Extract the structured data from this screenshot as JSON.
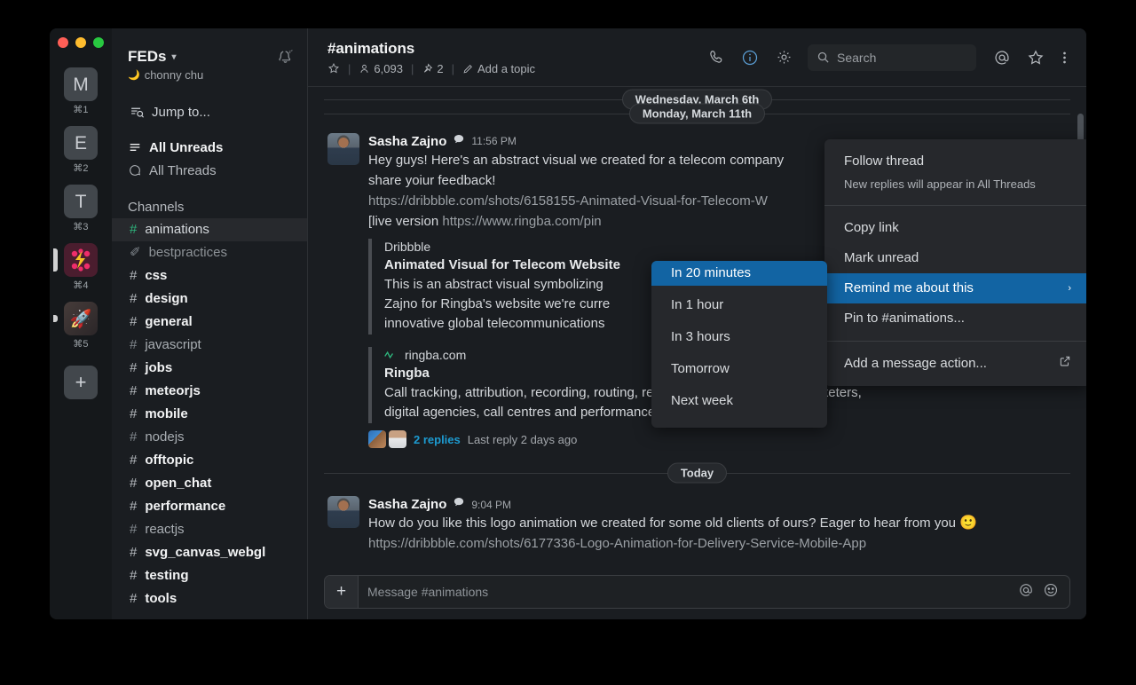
{
  "window": {
    "traffic_lights": [
      "close",
      "minimize",
      "maximize"
    ]
  },
  "rail": {
    "workspaces": [
      {
        "label": "M",
        "shortcut": "⌘1",
        "type": "letter"
      },
      {
        "label": "E",
        "shortcut": "⌘2",
        "type": "letter"
      },
      {
        "label": "T",
        "shortcut": "⌘3",
        "type": "letter"
      },
      {
        "label": "F",
        "shortcut": "⌘4",
        "type": "logo-f"
      },
      {
        "label": "🚀",
        "shortcut": "⌘5",
        "type": "logo-rocket"
      }
    ],
    "add_label": "+"
  },
  "sidebar": {
    "workspace_name": "FEDs",
    "caret": "⌄",
    "user_name": "chonny chu",
    "bell_icon": "notifications-snoozed-icon",
    "jump_to": "Jump to...",
    "quick_links": [
      {
        "label": "All Unreads",
        "strong": true
      },
      {
        "label": "All Threads",
        "strong": false
      }
    ],
    "section_title": "Channels",
    "channels": [
      {
        "name": "animations",
        "prefix": "#",
        "state": "active"
      },
      {
        "name": "bestpractices",
        "prefix": "✐",
        "state": "muted"
      },
      {
        "name": "css",
        "prefix": "#",
        "state": "unread"
      },
      {
        "name": "design",
        "prefix": "#",
        "state": "unread"
      },
      {
        "name": "general",
        "prefix": "#",
        "state": "unread"
      },
      {
        "name": "javascript",
        "prefix": "#",
        "state": "read"
      },
      {
        "name": "jobs",
        "prefix": "#",
        "state": "unread"
      },
      {
        "name": "meteorjs",
        "prefix": "#",
        "state": "unread"
      },
      {
        "name": "mobile",
        "prefix": "#",
        "state": "unread"
      },
      {
        "name": "nodejs",
        "prefix": "#",
        "state": "read"
      },
      {
        "name": "offtopic",
        "prefix": "#",
        "state": "unread"
      },
      {
        "name": "open_chat",
        "prefix": "#",
        "state": "unread"
      },
      {
        "name": "performance",
        "prefix": "#",
        "state": "unread"
      },
      {
        "name": "reactjs",
        "prefix": "#",
        "state": "read"
      },
      {
        "name": "svg_canvas_webgl",
        "prefix": "#",
        "state": "unread"
      },
      {
        "name": "testing",
        "prefix": "#",
        "state": "unread"
      },
      {
        "name": "tools",
        "prefix": "#",
        "state": "unread"
      }
    ]
  },
  "channel_header": {
    "title": "#animations",
    "star_icon": "star-icon",
    "members_icon": "person-icon",
    "members_count": "6,093",
    "pins_icon": "pin-icon",
    "pins_count": "2",
    "topic_icon": "pencil-icon",
    "topic_label": "Add a topic",
    "actions": {
      "call": "phone-icon",
      "info": "info-icon",
      "settings": "gear-icon",
      "mentions": "at-icon",
      "starred": "star-icon",
      "more": "more-vertical-icon"
    },
    "search_placeholder": "Search",
    "search_icon": "search-icon"
  },
  "messages": {
    "dividers": {
      "previous": "Wednesday, March 6th",
      "first": "Monday, March 11th",
      "second": "Today"
    },
    "items": [
      {
        "author": "Sasha Zajno",
        "badge_icon": "thread-badge-icon",
        "time": "11:56 PM",
        "lines": [
          "Hey guys! Here's an abstract visual we created for a telecom company ... share yoiur feedback!",
          "https://dribbble.com/shots/6158155-Animated-Visual-for-Telecom-W",
          "[live version https://www.ringba.com/pin"
        ],
        "line1a": "Hey guys! Here's an abstract visual we created for a telecom company",
        "line1b": "share yoiur feedback!",
        "attachments": [
          {
            "service": "Dribbble",
            "title": "Animated Visual for Telecom Website",
            "body_lines": [
              "This is an abstract visual symbolizing ",
              "Zajno for Ringba's website we're curre",
              "innovative global telecommunications"
            ]
          },
          {
            "service": "ringba.com",
            "service_icon": "ringba-wave-icon",
            "title": "Ringba",
            "body_lines": [
              "Call tracking, attribution, recording, routing, reporting and analytics for marketers,",
              "digital agencies, call centres and performance networks."
            ]
          }
        ],
        "replies_count": "2 replies",
        "replies_last": "Last reply 2 days ago"
      },
      {
        "author": "Sasha Zajno",
        "badge_icon": "thread-badge-icon",
        "time": "9:04 PM",
        "line1": "How do you like this logo animation we created for some old clients of ours? Eager to hear from you",
        "emoji": "🙂",
        "line2": "https://dribbble.com/shots/6177336-Logo-Animation-for-Delivery-Service-Mobile-App"
      }
    ],
    "hover_actions_icon": "more-actions-icon"
  },
  "composer": {
    "plus_icon": "plus-icon",
    "placeholder": "Message #animations",
    "mention_icon": "at-icon",
    "emoji_icon": "emoji-icon"
  },
  "context_menu": {
    "items": [
      {
        "label": "Follow thread",
        "sub": "New replies will appear in All Threads",
        "type": "item-with-sub"
      },
      {
        "type": "divider"
      },
      {
        "label": "Copy link",
        "type": "item"
      },
      {
        "label": "Mark unread",
        "type": "item"
      },
      {
        "label": "Remind me about this",
        "type": "item",
        "highlighted": true,
        "chevron": "›"
      },
      {
        "label": "Pin to #animations...",
        "type": "item"
      },
      {
        "type": "divider"
      },
      {
        "label": "Add a message action...",
        "type": "item",
        "external_icon": "external-link-icon"
      }
    ]
  },
  "submenu": {
    "items": [
      {
        "label": "In 20 minutes",
        "highlighted": true
      },
      {
        "label": "In 1 hour",
        "highlighted": false
      },
      {
        "label": "In 3 hours",
        "highlighted": false
      },
      {
        "label": "Tomorrow",
        "highlighted": false
      },
      {
        "label": "Next week",
        "highlighted": false
      }
    ]
  },
  "colors": {
    "app_bg": "#1a1d21",
    "rail_bg": "#15181b",
    "menu_bg": "#26282c",
    "highlight_blue": "#1264a3",
    "link_blue": "#1d9bd1",
    "hash_green": "#2eb67d",
    "text_primary": "#f2f3f4",
    "text_secondary": "#a9aeb3"
  }
}
